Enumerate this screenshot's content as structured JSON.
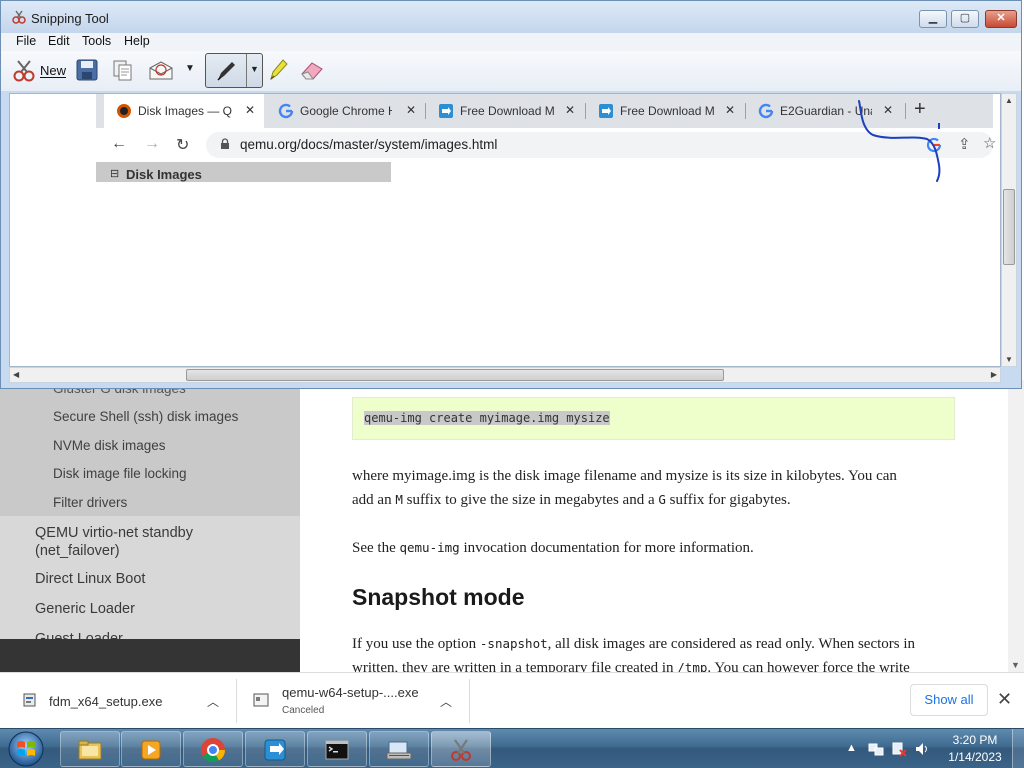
{
  "snipping_tool": {
    "title": "Snipping Tool",
    "menu": [
      "File",
      "Edit",
      "Tools",
      "Help"
    ],
    "toolbar": {
      "new_label": "New"
    }
  },
  "snip": {
    "tabs": [
      {
        "label": "Disk Images — Q",
        "active": true
      },
      {
        "label": "Google Chrome H",
        "active": false
      },
      {
        "label": "Free Download M",
        "active": false
      },
      {
        "label": "Free Download M",
        "active": false
      },
      {
        "label": "E2Guardian - Una",
        "active": false
      }
    ],
    "url": "qemu.org/docs/master/system/images.html",
    "disk_heading": "Disk Images"
  },
  "sidebar": {
    "sub_items": [
      "Secure Shell (ssh) disk images",
      "NVMe disk images",
      "Disk image file locking",
      "Filter drivers"
    ],
    "top_items": [
      "QEMU virtio-net standby",
      "(net_failover)",
      "Direct Linux Boot",
      "Generic Loader",
      "Guest Loader"
    ],
    "cut_item": "Gluster G disk images"
  },
  "content": {
    "code": "qemu-img create myimage.img mysize",
    "para1_line1": "where myimage.img is the disk image filename and mysize is its size in kilobytes. You can",
    "para1_line2_a": "add an ",
    "para1_line2_m": "M",
    "para1_line2_b": " suffix to give the size in megabytes and a ",
    "para1_line2_g": "G",
    "para1_line2_c": " suffix for gigabytes.",
    "para2_a": "See the ",
    "para2_code": "qemu-img",
    "para2_b": " invocation documentation for more information.",
    "heading": "Snapshot mode",
    "para3_line1_a": "If you use the option ",
    "para3_line1_code": "-snapshot",
    "para3_line1_b": ", all disk images are considered as read only. When sectors in",
    "para3_line2_a": "written, they are written in a temporary file created in ",
    "para3_line2_code": "/tmp",
    "para3_line2_b": ". You can however force the write"
  },
  "downloads": {
    "items": [
      {
        "name": "fdm_x64_setup.exe",
        "status": ""
      },
      {
        "name": "qemu-w64-setup-....exe",
        "status": "Canceled"
      }
    ],
    "show_all": "Show all"
  },
  "taskbar": {
    "time": "3:20 PM",
    "date": "1/14/2023"
  },
  "colors": {
    "code_bg": "#eeffcc",
    "sidebar_bg": "#d8d8d8",
    "taskbar": "#3e6a90",
    "link_blue": "#1a73e8",
    "annotation_ink": "#1a3fbf"
  }
}
